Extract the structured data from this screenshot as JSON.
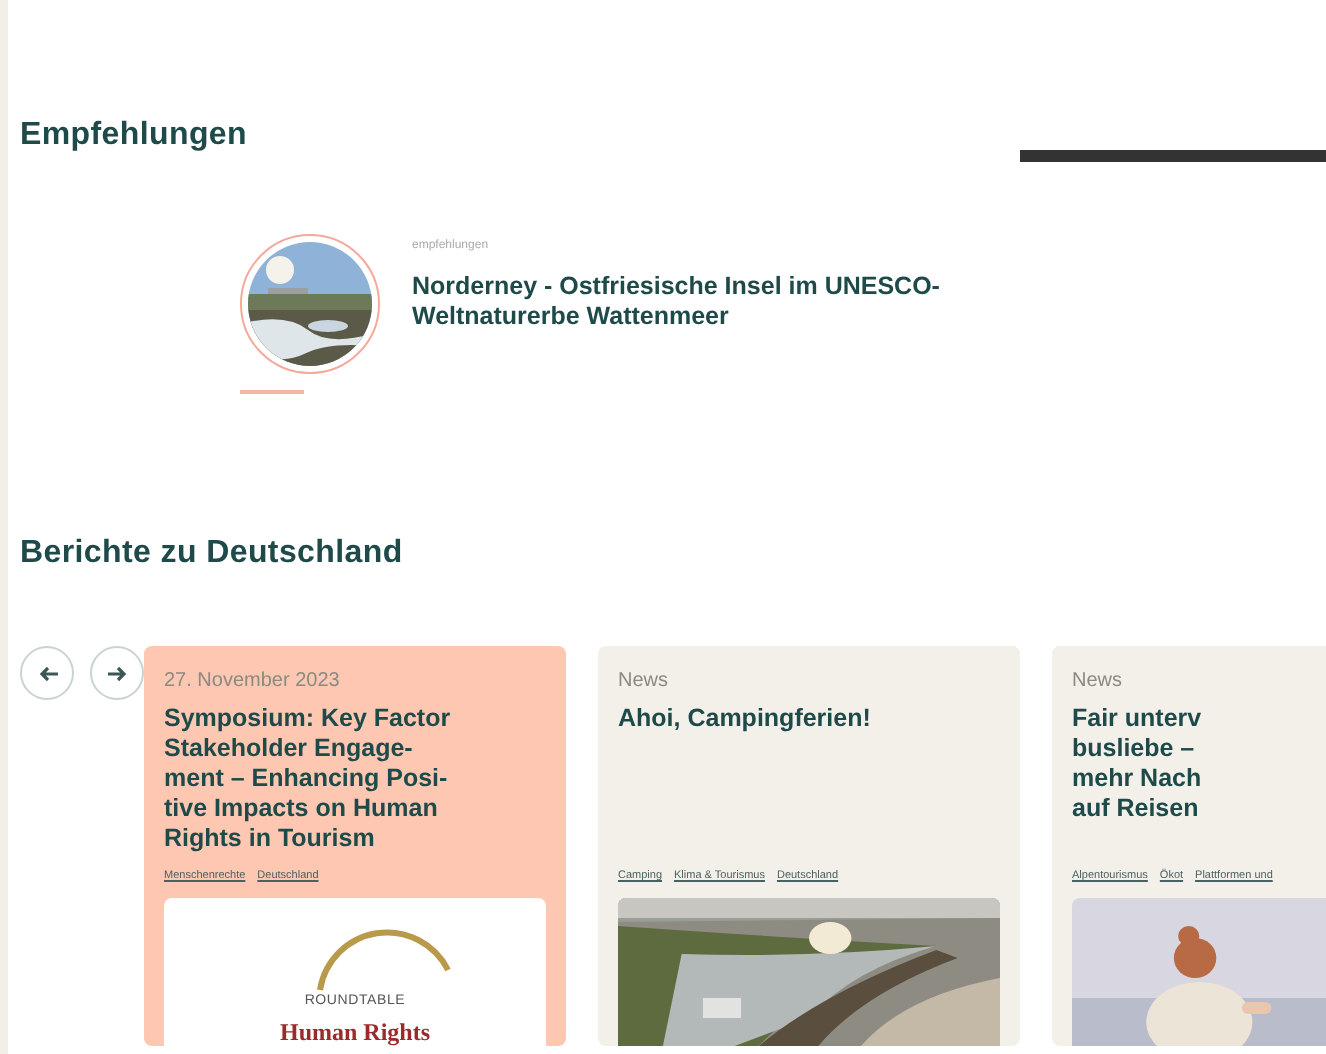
{
  "recommendations": {
    "heading": "Empfehlungen",
    "items": [
      {
        "label": "empfehlungen",
        "title": "Norderney - Ostfriesische Insel im UNESCO-Weltnaturerbe Wattenmeer"
      }
    ]
  },
  "reports": {
    "heading": "Berichte zu Deutschland",
    "nav": [
      {
        "kind": "prev"
      },
      {
        "kind": "next"
      }
    ],
    "cards": [
      {
        "kind": "highlight",
        "meta": "27. November 2023",
        "title_lines": [
          "Symposium: Key Factor",
          "Stakeholder Engage-",
          "ment – Enhancing Posi-",
          "tive Impacts on Human",
          "Rights in Tourism"
        ],
        "tags": [
          "Menschenrechte",
          "Deutschland"
        ],
        "image": {
          "kind": "logo",
          "texts": [
            "ROUNDTABLE",
            "Human Rights"
          ]
        }
      },
      {
        "kind": "plain",
        "meta": "News",
        "title_lines": [
          "Ahoi, Campingferien!"
        ],
        "tags": [
          "Camping",
          "Klima & Tourismus",
          "Deutschland"
        ],
        "image": {
          "kind": "coast"
        }
      },
      {
        "kind": "plain",
        "meta": "News",
        "title_lines": [
          "Fair unterv",
          "busliebe –",
          "mehr Nach",
          "auf Reisen"
        ],
        "tags": [
          "Alpentourismus",
          "Ökot",
          "Plattformen und"
        ],
        "image": {
          "kind": "figure"
        }
      }
    ]
  }
}
